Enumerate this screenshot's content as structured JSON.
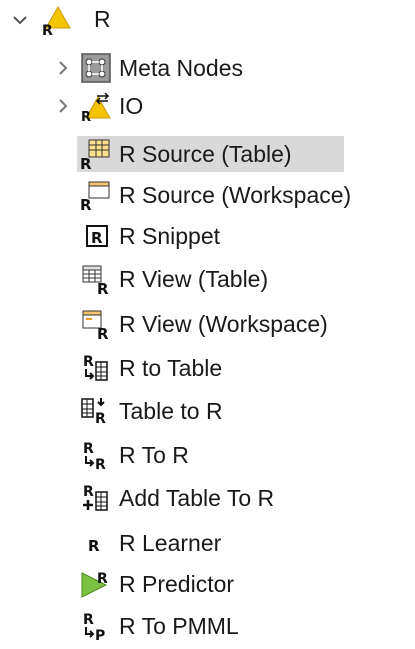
{
  "tree": {
    "root": {
      "label": "R",
      "icon": "r-extension-icon",
      "expanded": true
    },
    "children": [
      {
        "label": "Meta Nodes",
        "icon": "meta-nodes-icon",
        "collapsed": true
      },
      {
        "label": "IO",
        "icon": "r-io-icon",
        "collapsed": true
      },
      {
        "label": "R Source (Table)",
        "icon": "r-source-table-icon",
        "selected": true
      },
      {
        "label": "R Source (Workspace)",
        "icon": "r-source-workspace-icon"
      },
      {
        "label": "R Snippet",
        "icon": "r-snippet-icon"
      },
      {
        "label": "R View (Table)",
        "icon": "r-view-table-icon"
      },
      {
        "label": "R View (Workspace)",
        "icon": "r-view-workspace-icon"
      },
      {
        "label": "R to Table",
        "icon": "r-to-table-icon"
      },
      {
        "label": "Table to R",
        "icon": "table-to-r-icon"
      },
      {
        "label": "R To R",
        "icon": "r-to-r-icon"
      },
      {
        "label": "Add Table To R",
        "icon": "add-table-to-r-icon"
      },
      {
        "label": "R Learner",
        "icon": "r-learner-icon"
      },
      {
        "label": "R Predictor",
        "icon": "r-predictor-icon"
      },
      {
        "label": "R To PMML",
        "icon": "r-to-pmml-icon"
      }
    ]
  },
  "colors": {
    "selection": "#d9d9d9",
    "chevron": "#555555",
    "accent_yellow": "#f5c400",
    "accent_green": "#7cc242",
    "table_fill": "#fce08a",
    "window_header": "#f7c469"
  }
}
